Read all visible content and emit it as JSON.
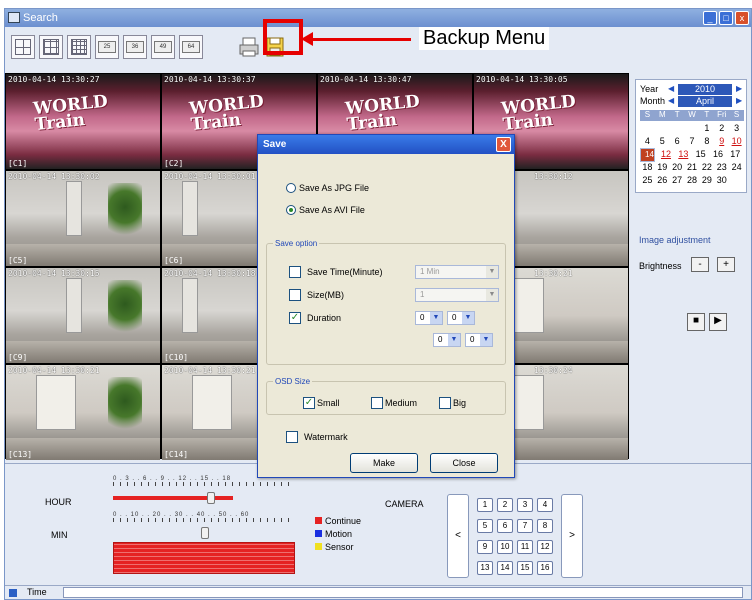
{
  "window": {
    "title": "Search"
  },
  "toolbar": {
    "layouts": [
      "25",
      "36",
      "49",
      "64"
    ],
    "backup_label": "Backup Menu"
  },
  "cameras": [
    {
      "ts": "2010-04-14 13:30:27",
      "id": "[C1]"
    },
    {
      "ts": "2010-04-14 13:30:37",
      "id": "[C2]"
    },
    {
      "ts": "2010-04-14 13:30:47",
      "id": ""
    },
    {
      "ts": "2010-04-14 13:30:05",
      "id": ""
    },
    {
      "ts": "2010-04-14 13:30:02",
      "id": "[C5]"
    },
    {
      "ts": "2010-04-14 13:30:01",
      "id": "[C6]"
    },
    {
      "ts": "",
      "id": ""
    },
    {
      "ts": "13:30:12",
      "id": ""
    },
    {
      "ts": "2010-04-14 13:30:15",
      "id": "[C9]"
    },
    {
      "ts": "2010-04-14 13:30:18",
      "id": "[C10]"
    },
    {
      "ts": "",
      "id": ""
    },
    {
      "ts": "13:30:21",
      "id": ""
    },
    {
      "ts": "2010-04-14 13:30:21",
      "id": "[C13]"
    },
    {
      "ts": "2010-04-14 13:30:21",
      "id": "[C14]"
    },
    {
      "ts": "",
      "id": ""
    },
    {
      "ts": "13:30:24",
      "id": ""
    }
  ],
  "calendar": {
    "year_label": "Year",
    "year": "2010",
    "month_label": "Month",
    "month": "April",
    "weekdays": [
      "S",
      "M",
      "T",
      "W",
      "T",
      "Fri",
      "S"
    ],
    "weeks": [
      [
        "",
        "",
        "",
        "",
        "1",
        "2",
        "3"
      ],
      [
        "4",
        "5",
        "6",
        "7",
        "8",
        "9",
        "10"
      ],
      [
        "11",
        "12",
        "13",
        "14",
        "15",
        "16",
        "17"
      ],
      [
        "18",
        "19",
        "20",
        "21",
        "22",
        "23",
        "24"
      ],
      [
        "25",
        "26",
        "27",
        "28",
        "29",
        "30",
        ""
      ]
    ],
    "selected_day": "14"
  },
  "image_adjust": {
    "title": "Image adjustment",
    "brightness": "Brightness",
    "minus": "-",
    "plus": "+"
  },
  "timeline": {
    "hour_label": "HOUR",
    "min_label": "MIN",
    "hour_ticks": "0 . 3 . . 6 . . 9 . . 12 . . 15 . . 18",
    "min_ticks": "0 . . 10 . . 20 . . 30 . . 40 . . 50 . . 60",
    "legend": [
      {
        "label": "Continue",
        "color": "#e52222"
      },
      {
        "label": "Motion",
        "color": "#1a2fe0"
      },
      {
        "label": "Sensor",
        "color": "#f0e020"
      }
    ],
    "camera_label": "CAMERA",
    "camera_buttons": [
      "1",
      "2",
      "3",
      "4",
      "5",
      "6",
      "7",
      "8",
      "9",
      "10",
      "11",
      "12",
      "13",
      "14",
      "15",
      "16"
    ],
    "prev": "<",
    "next": ">"
  },
  "status": {
    "label": "Time"
  },
  "dialog": {
    "title": "Save",
    "close_glyph": "X",
    "save_jpg": "Save As JPG File",
    "save_avi": "Save As AVI File",
    "save_option_title": "Save option",
    "save_time_label": "Save Time(Minute)",
    "save_time_value": "1 Min",
    "size_label": "Size(MB)",
    "size_value": "1",
    "duration_label": "Duration",
    "dur1": "0",
    "dur2": "0",
    "dur3": "0",
    "dur4": "0",
    "osd_title": "OSD Size",
    "osd_small": "Small",
    "osd_medium": "Medium",
    "osd_big": "Big",
    "watermark": "Watermark",
    "make": "Make",
    "close": "Close"
  },
  "colors": {
    "accent": "#2148b8",
    "record": "#e52222",
    "highlight": "#e60000"
  }
}
